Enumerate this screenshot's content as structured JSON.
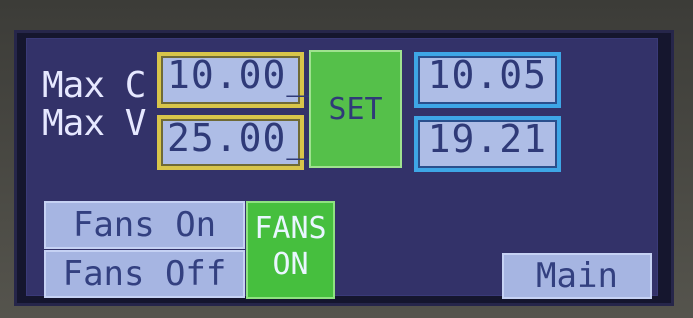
{
  "labels": {
    "max_c": "Max C",
    "max_v": "Max V"
  },
  "inputs": {
    "max_c_value": "10.00_",
    "max_v_value": "25.00_"
  },
  "buttons": {
    "set": "SET",
    "fans_on": "Fans On",
    "fans_off": "Fans Off",
    "main": "Main"
  },
  "readings": {
    "current": "10.05",
    "voltage": "19.21"
  },
  "fans_state": {
    "line1": "FANS",
    "line2": "ON"
  }
}
